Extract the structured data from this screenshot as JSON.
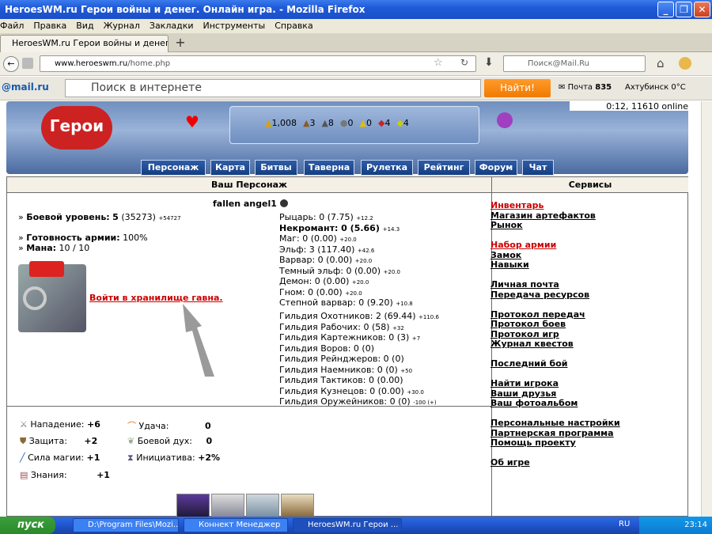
{
  "window": {
    "title": "HeroesWM.ru Герои войны и денег. Онлайн игра. - Mozilla Firefox"
  },
  "menu": [
    "Файл",
    "Правка",
    "Вид",
    "Журнал",
    "Закладки",
    "Инструменты",
    "Справка"
  ],
  "tab": {
    "title": "HeroesWM.ru Герои войны и денег. Онла..."
  },
  "nav": {
    "url_domain": "www.heroeswm.ru",
    "url_path": "/home.php",
    "search_placeholder": "Поиск@Mail.Ru"
  },
  "mailbar": {
    "logo": "@mail.ru",
    "search_placeholder": "Поиск в интернете",
    "find_button": "Найти!",
    "mail_label": "Почта",
    "mail_count": "835",
    "weather": "Ахтубинск 0°C"
  },
  "game": {
    "online_status": "0:12, 11610 online",
    "resources": [
      "1,008",
      "3",
      "8",
      "0",
      "0",
      "4",
      "4"
    ],
    "nav": [
      "Персонаж",
      "Карта",
      "Битвы",
      "Таверна",
      "Рулетка",
      "Рейтинг",
      "Форум",
      "Чат"
    ],
    "headers": {
      "character": "Ваш Персонаж",
      "services": "Сервисы"
    },
    "player_name": "fallen angel1",
    "combat_level_label": "Боевой уровень:",
    "combat_level": "5",
    "combat_level_exp": "(35273)",
    "combat_level_next": "+54727",
    "army_ready_label": "Готовность армии:",
    "army_ready": "100%",
    "mana_label": "Мана:",
    "mana": "10 / 10",
    "vault_link": "Войти в хранилище гавна.",
    "factions": [
      {
        "label": "Рыцарь: 0 (7.75)",
        "delta": "+12.2"
      },
      {
        "label": "Некромант: 0 (5.66)",
        "delta": "+14.3"
      },
      {
        "label": "Маг: 0 (0.00)",
        "delta": "+20.0"
      },
      {
        "label": "Эльф: 3 (117.40)",
        "delta": "+42.6"
      },
      {
        "label": "Варвар: 0 (0.00)",
        "delta": "+20.0"
      },
      {
        "label": "Темный эльф: 0 (0.00)",
        "delta": "+20.0"
      },
      {
        "label": "Демон: 0 (0.00)",
        "delta": "+20.0"
      },
      {
        "label": "Гном: 0 (0.00)",
        "delta": "+20.0"
      },
      {
        "label": "Степной варвар: 0 (9.20)",
        "delta": "+10.8"
      }
    ],
    "guilds": [
      {
        "label": "Гильдия Охотников: 2 (69.44)",
        "delta": "+110.6"
      },
      {
        "label": "Гильдия Рабочих: 0 (58)",
        "delta": "+32"
      },
      {
        "label": "Гильдия Картежников: 0 (3)",
        "delta": "+7"
      },
      {
        "label": "Гильдия Воров: 0 (0)",
        "delta": ""
      },
      {
        "label": "Гильдия Рейнджеров: 0 (0)",
        "delta": ""
      },
      {
        "label": "Гильдия Наемников: 0 (0)",
        "delta": "+50"
      },
      {
        "label": "Гильдия Тактиков: 0 (0.00)",
        "delta": ""
      },
      {
        "label": "Гильдия Кузнецов: 0 (0.00)",
        "delta": "+30.0"
      },
      {
        "label": "Гильдия Оружейников: 0 (0)",
        "delta": "-100 (+)"
      }
    ],
    "stats": [
      {
        "label": "Нападение:",
        "value": "+6"
      },
      {
        "label": "Защита:",
        "value": "+2"
      },
      {
        "label": "Сила магии:",
        "value": "+1"
      },
      {
        "label": "Знания:",
        "value": "+1"
      },
      {
        "label": "Удача:",
        "value": "0"
      },
      {
        "label": "Боевой дух:",
        "value": "0"
      },
      {
        "label": "Инициатива:",
        "value": "+2%"
      }
    ],
    "services": [
      {
        "label": "Инвентарь",
        "red": true
      },
      {
        "label": "Магазин артефактов"
      },
      {
        "label": "Рынок"
      },
      {
        "label": ""
      },
      {
        "label": "Набор армии",
        "red": true
      },
      {
        "label": "Замок"
      },
      {
        "label": "Навыки"
      },
      {
        "label": ""
      },
      {
        "label": "Личная почта"
      },
      {
        "label": "Передача ресурсов"
      },
      {
        "label": ""
      },
      {
        "label": "Протокол передач"
      },
      {
        "label": "Протокол боев"
      },
      {
        "label": "Протокол игр"
      },
      {
        "label": "Журнал квестов"
      },
      {
        "label": ""
      },
      {
        "label": "Последний бой"
      },
      {
        "label": ""
      },
      {
        "label": "Найти игрока"
      },
      {
        "label": "Ваши друзья"
      },
      {
        "label": "Ваш фотоальбом"
      },
      {
        "label": ""
      },
      {
        "label": "Персональные настройки"
      },
      {
        "label": "Партнерская программа"
      },
      {
        "label": "Помощь проекту"
      },
      {
        "label": ""
      },
      {
        "label": "Об игре"
      }
    ]
  },
  "taskbar": {
    "start": "пуск",
    "tasks": [
      "D:\\Program Files\\Mozi...",
      "Коннект Менеджер",
      "HeroesWM.ru Герои ..."
    ],
    "lang": "RU",
    "time": "23:14"
  }
}
